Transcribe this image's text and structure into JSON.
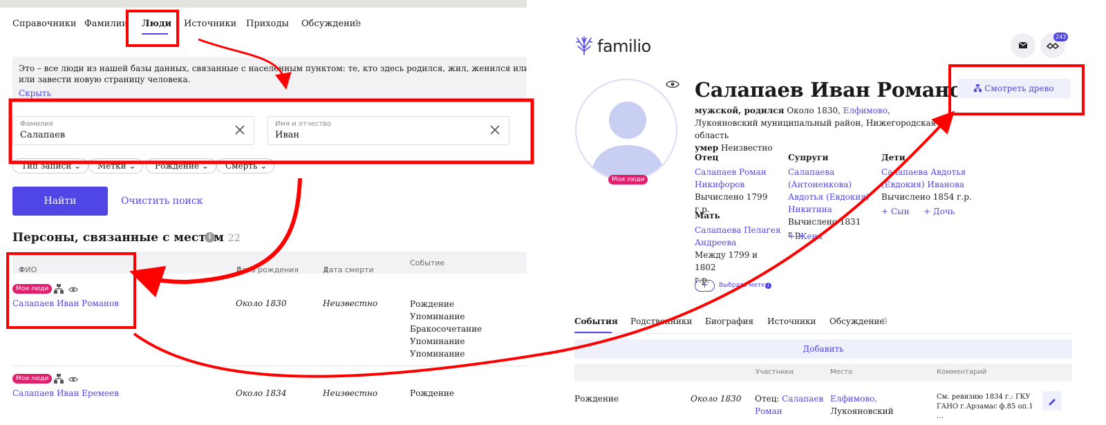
{
  "left": {
    "tabs": [
      {
        "label": "Справочники"
      },
      {
        "label": "Фамилии"
      },
      {
        "label": "Люди"
      },
      {
        "label": "Источники"
      },
      {
        "label": "Приходы"
      },
      {
        "label": "Обсуждение",
        "count": "1"
      }
    ],
    "info": {
      "line1": "Это – все люди из нашей базы данных, связанные с населенным пунктом: те, кто здесь родился, жил, женился или умер. Вы мож",
      "line2": "или завести новую страницу человека.",
      "hide": "Скрыть"
    },
    "search": {
      "surname_label": "Фамилия",
      "surname_value": "Салапаев",
      "given_label": "Имя и отчество",
      "given_value": "Иван"
    },
    "filters": [
      "Тип записи",
      "Метки",
      "Рождение",
      "Смерть"
    ],
    "find_button": "Найти",
    "clear_link": "Очистить поиск",
    "section_title": "Персоны, связанные с местом",
    "section_count": "22",
    "columns": [
      "ФИО",
      "Дата рождения",
      "Дата смерти",
      "Событие"
    ],
    "rows": [
      {
        "badge": "Мои люди",
        "name": "Салапаев Иван Романов",
        "birth": "Около 1830",
        "death": "Неизвестно",
        "events": [
          "Рождение",
          "Упоминание",
          "Бракосочетание",
          "Упоминание",
          "Упоминание"
        ]
      },
      {
        "badge": "Мои люди",
        "name": "Салапаев Иван Еремеев",
        "birth": "Около 1834",
        "death": "Неизвестно",
        "events": [
          "Рождение"
        ]
      }
    ]
  },
  "right": {
    "brand": "familio",
    "notifications": "243",
    "avatar_badge": "Мои люди",
    "person_name": "Салапаев Иван Романов",
    "bio": {
      "sex": "мужской",
      "born_label": "родился",
      "born_text": "Около 1830,",
      "place_link": "Елфимово",
      "place_rest": ", Лукояновский муниципальный район, Нижегородская область",
      "died_label": "умер",
      "died_text": "Неизвестно"
    },
    "tree_button": "Смотреть древо",
    "father": {
      "heading": "Отец",
      "name_line1": "Салапаев Роман",
      "name_line2": "Никифоров",
      "date": "Вычислено 1799 г.р."
    },
    "mother": {
      "heading": "Мать",
      "name_line1": "Салапаева Пелагея",
      "name_line2": "Андреева",
      "date_line1": "Между 1799 и 1802",
      "date_line2": "г.р."
    },
    "spouses": {
      "heading": "Супруги",
      "lines": [
        "Салапаева",
        "(Антоненкова)",
        "Авдотья (Евдокия)",
        "Никитина"
      ],
      "date": "Вычислено 1831 г.р.",
      "add": "+ Жена"
    },
    "children": {
      "heading": "Дети",
      "lines": [
        "Салапаева Авдотья",
        "(Евдокия) Иванова"
      ],
      "date": "Вычислено 1854 г.р.",
      "add_son": "+ Сын",
      "add_daughter": "+ Дочь"
    },
    "tag_label": "Выбрать метку",
    "tabs": [
      {
        "label": "События"
      },
      {
        "label": "Родственники"
      },
      {
        "label": "Биография"
      },
      {
        "label": "Источники"
      },
      {
        "label": "Обсуждение",
        "count": "0"
      }
    ],
    "add_button": "Добавить",
    "table_columns": [
      "Участники",
      "Место",
      "Комментарий"
    ],
    "event_row": {
      "type": "Рождение",
      "date": "Около 1830",
      "participant_label": "Отец:",
      "participant_line1": "Салапаев",
      "participant_line2": "Роман",
      "place_link": "Елфимово,",
      "place_rest": "Лукояновский",
      "comment_line1": "См. ревизию 1834 г.: ГКУ",
      "comment_line2": "ГАНО г.Арзамас ф.85 оп.1",
      "comment_line3": "…"
    }
  },
  "colors": {
    "accent": "#4f46e5",
    "badge": "#e0226e",
    "annotation": "#ff0000"
  }
}
